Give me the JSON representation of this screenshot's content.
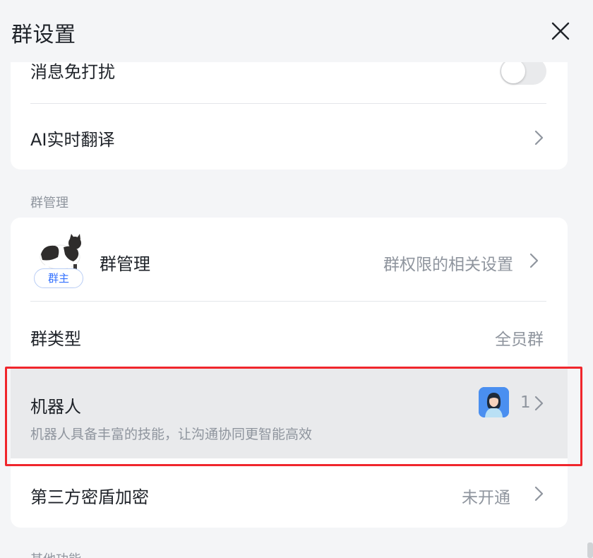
{
  "header": {
    "title": "群设置",
    "close_icon": "close-icon"
  },
  "basic_card": {
    "dnd_label": "消息免打扰",
    "dnd_enabled": false,
    "translate_label": "AI实时翻译"
  },
  "group_management_section": {
    "label": "群管理",
    "manage_row": {
      "label": "群管理",
      "badge": "群主",
      "value": "群权限的相关设置"
    },
    "type_row": {
      "label": "群类型",
      "value": "全员群"
    },
    "bots_row": {
      "label": "机器人",
      "description": "机器人具备丰富的技能，让沟通协同更智能高效",
      "count": "1"
    },
    "encryption_row": {
      "label": "第三方密盾加密",
      "value": "未开通"
    }
  },
  "other_section": {
    "label": "其他功能"
  },
  "colors": {
    "background": "#f4f5f7",
    "card": "#ffffff",
    "highlight": "#e9eaec",
    "accent": "#3370ff",
    "annotation_red": "#f0262c"
  }
}
